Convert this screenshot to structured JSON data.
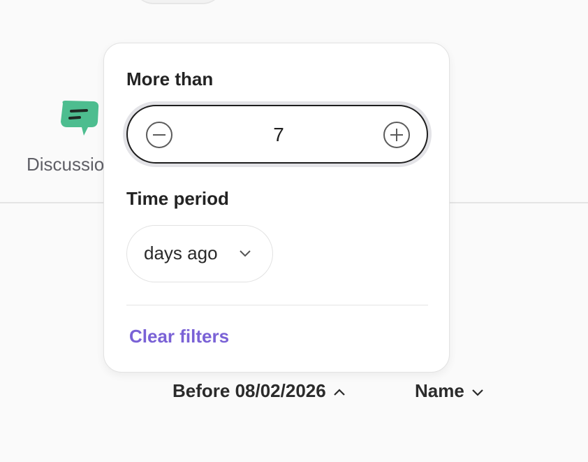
{
  "background_item": {
    "label": "Discussio",
    "icon": "chat-bubble-icon",
    "icon_color": "#4dbd8f"
  },
  "popover": {
    "count_label": "More than",
    "count_value": "7",
    "decrement_icon": "minus-circle-icon",
    "increment_icon": "plus-circle-icon",
    "period_label": "Time period",
    "period_selected": "days ago",
    "period_icon": "chevron-down-icon",
    "clear_label": "Clear filters",
    "accent_color": "#7a62d6"
  },
  "sort_bar": {
    "date_filter_label": "Before 08/02/2026",
    "date_filter_icon": "chevron-up-icon",
    "name_sort_label": "Name",
    "name_sort_icon": "chevron-down-icon"
  }
}
